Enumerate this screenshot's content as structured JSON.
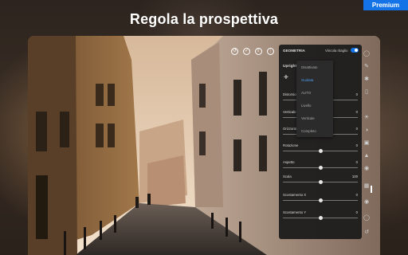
{
  "banner": {
    "premium_label": "Premium"
  },
  "headline": "Regola la prospettiva",
  "toolbar_icons": [
    "undo-icon",
    "check-icon",
    "share-icon",
    "more-icon"
  ],
  "panel": {
    "title": "GEOMETRIA",
    "crop_lock_label": "Vincola ritaglio",
    "crop_lock_on": true,
    "upright_label": "Upright",
    "rows": [
      {
        "label": "Distorsione",
        "value": "0",
        "fraction": 0.5
      },
      {
        "label": "Verticale",
        "value": "0",
        "fraction": 0.5
      },
      {
        "label": "Orizzontale",
        "value": "0",
        "fraction": 0.5
      },
      {
        "label": "Rotazione",
        "value": "0",
        "fraction": 0.5
      },
      {
        "label": "Aspetto",
        "value": "0",
        "fraction": 0.5
      },
      {
        "label": "Scala",
        "value": "100",
        "fraction": 0.5
      },
      {
        "label": "Scostamento X",
        "value": "0",
        "fraction": 0.5
      },
      {
        "label": "Scostamento Y",
        "value": "0",
        "fraction": 0.5
      }
    ],
    "dropdown": {
      "options": [
        "Disattivato",
        "Guidata",
        "AUTO",
        "Livello",
        "Verticale",
        "Completo"
      ],
      "selected_index": 1
    }
  },
  "rail_icons": [
    "circle-icon",
    "brush-icon",
    "heal-icon",
    "eraser-icon",
    "light-icon",
    "color-icon",
    "effects-icon",
    "detail-icon",
    "optics-icon",
    "geometry-icon",
    "presets-icon",
    "versions-icon",
    "history-icon"
  ],
  "colors": {
    "accent": "#1473e6",
    "premium": "#1473e6",
    "panel_bg": "#1c1c1c"
  }
}
